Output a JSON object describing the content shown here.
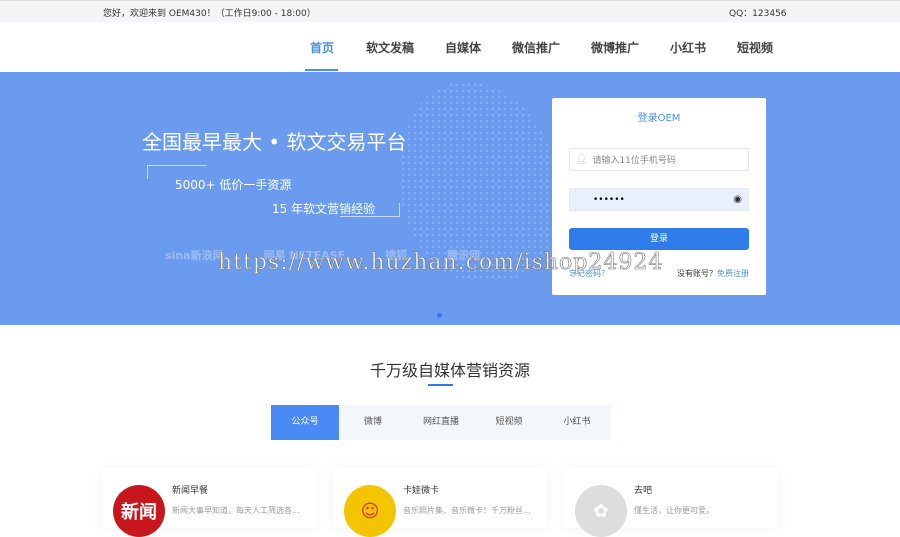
{
  "topbar": {
    "greeting": "您好，欢迎来到 OEM430！（工作日9:00 - 18:00）",
    "qq": "QQ：123456"
  },
  "nav": [
    "首页",
    "软文发稿",
    "自媒体",
    "微信推广",
    "微博推广",
    "小红书",
    "短视频"
  ],
  "banner": {
    "title": "全国最早最大 • 软文交易平台",
    "sub1": "5000+ 低价一手资源",
    "sub2": "15 年软文营销经验",
    "logos": [
      "sina新浪网",
      "网易 NETEASE",
      "搜狐",
      "腾讯网"
    ]
  },
  "login": {
    "title": "登录OEM",
    "phone_placeholder": "请输入11位手机号码",
    "password_value": "••••••",
    "submit": "登录",
    "forgot": "忘记密码？",
    "no_account": "没有账号？",
    "register": "免费注册"
  },
  "watermark": "https://www.huzhan.com/ishop24924",
  "section": {
    "title": "千万级自媒体营销资源",
    "tabs": [
      "公众号",
      "微博",
      "网红直播",
      "短视频",
      "小红书"
    ]
  },
  "cards": [
    {
      "name": "新闻早餐",
      "desc": "新闻大事早知道，每天人工筛选各...",
      "avatar": "新闻",
      "color": "#c8161d"
    },
    {
      "name": "卡娃微卡",
      "desc": "音乐照片集、音乐微卡！千万粉丝...",
      "avatar": "☺",
      "color": "#f5c400"
    },
    {
      "name": "去吧",
      "desc": "懂生活，让你更可爱。",
      "avatar": "✿",
      "color": "#ddd"
    }
  ]
}
